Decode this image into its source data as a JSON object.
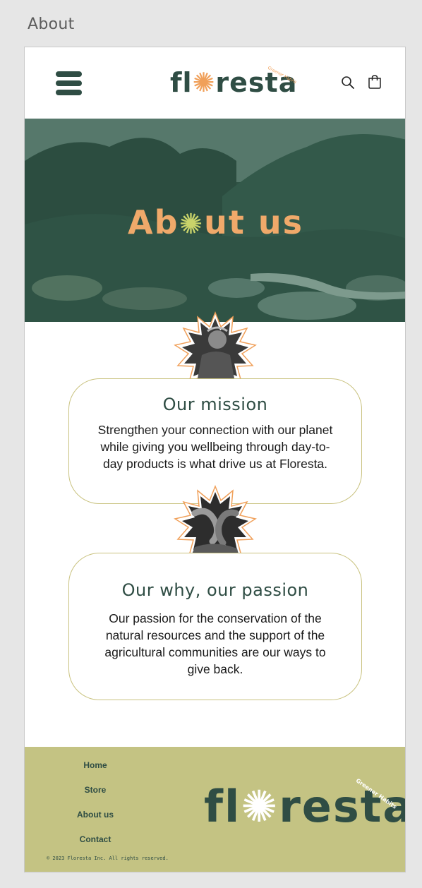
{
  "frame": {
    "title": "About"
  },
  "brand": {
    "name_prefix": "fl",
    "name_suffix": "resta",
    "tagline": "Greener Habits"
  },
  "header": {
    "menu_icon": "hamburger-menu-icon",
    "search_icon": "search-icon",
    "cart_icon": "shopping-bag-icon"
  },
  "hero": {
    "title_prefix": "Ab",
    "title_suffix": "ut us"
  },
  "mission": {
    "title": "Our mission",
    "text": "Strengthen your connection with our planet while giving you wellbeing through day-to-day products is what drive us at Floresta."
  },
  "why": {
    "title": "Our why, our passion",
    "text": "Our passion for the conservation of the natural resources and the support of the agricultural communities are our ways to give back."
  },
  "footer": {
    "links": [
      "Home",
      "Store",
      "About us",
      "Contact"
    ],
    "copyright": "© 2023 Floresta Inc. All rights reserved."
  },
  "colors": {
    "brand_green": "#2f4d44",
    "accent_orange": "#f0a96a",
    "footer_olive": "#c4c383",
    "card_border": "#c9c27f"
  }
}
